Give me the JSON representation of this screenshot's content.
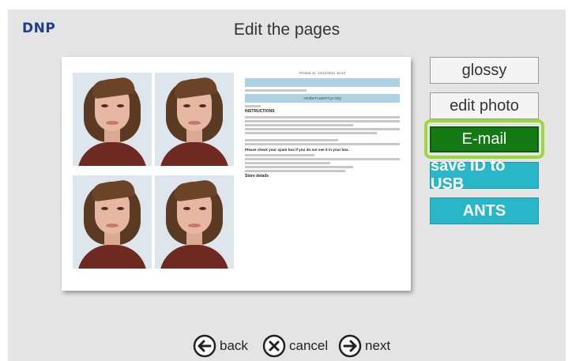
{
  "header": {
    "logo": "DNP",
    "title": "Edit the pages"
  },
  "actions": {
    "glossy": "glossy",
    "edit_photo": "edit photo",
    "email": "E-mail",
    "save_id_usb": "save ID to USB",
    "ants": "ANTS"
  },
  "footer": {
    "back": "back",
    "cancel": "cancel",
    "next": "next"
  },
  "colors": {
    "email_bg": "#137a14",
    "highlight": "#9bd83a",
    "teal": "#29b6c8",
    "logo": "#1d3d8f"
  },
  "preview": {
    "doc_header": "Printed on: 12/12/2021 15:24",
    "code": "HF3DFFU4ERTQA7ZQ",
    "instructions_title": "INSTRUCTIONS",
    "spam_notice": "Please check your spam box if you do not see it in your box.",
    "store_details": "Store details"
  }
}
